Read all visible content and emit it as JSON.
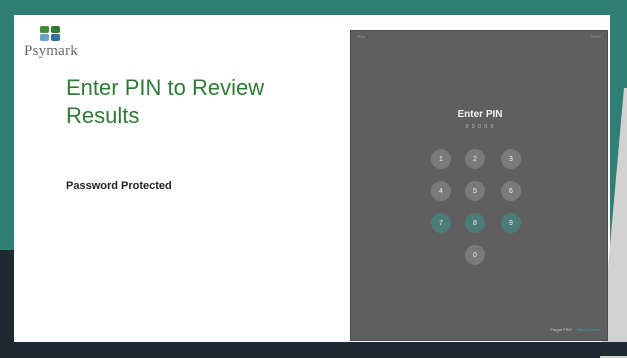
{
  "logo": {
    "text": "Psymark",
    "colors": [
      "#2f7a35",
      "#3f8f3a",
      "#2f6ea0",
      "#6a9fc5"
    ]
  },
  "title": "Enter PIN to Review Results",
  "subtitle": "Password Protected",
  "ipad": {
    "status_left": "iPad",
    "status_right": "100%",
    "prompt": "Enter PIN",
    "dots": "0 0 0 0 0",
    "keypad": [
      "1",
      "2",
      "3",
      "4",
      "5",
      "6",
      "7",
      "8",
      "9",
      "0"
    ],
    "footer": {
      "forgot": "Forgot PIN?",
      "reset": "Reset Device"
    }
  }
}
